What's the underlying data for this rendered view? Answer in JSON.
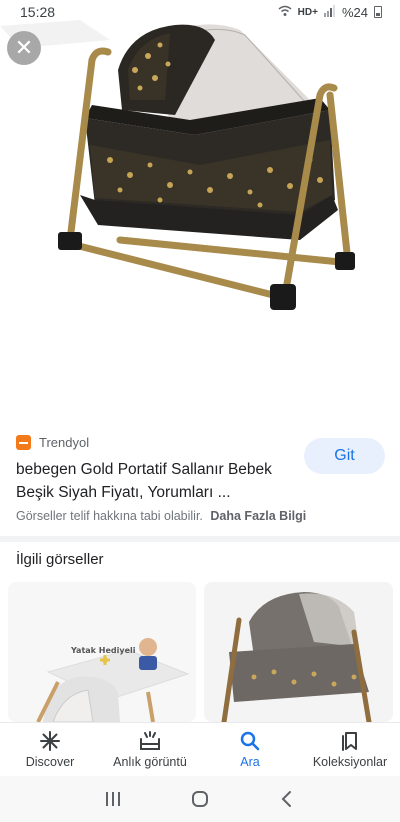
{
  "status_bar": {
    "time": "15:28",
    "network": "HD+",
    "battery": "%24"
  },
  "result": {
    "source": "Trendyol",
    "go_label": "Git",
    "title": "bebegen Gold Portatif Sallanır Bebek Beşik Siyah Fiyatı, Yorumları ...",
    "copyright_notice": "Görseller telif hakkına tabi olabilir.",
    "more_info": "Daha Fazla Bilgi"
  },
  "related": {
    "heading": "İlgili görseller",
    "thumb1_caption": "Yatak Hediyeli"
  },
  "bottom_nav": [
    {
      "label": "Discover",
      "icon": "asterisk-icon"
    },
    {
      "label": "Anlık görüntü",
      "icon": "snapshot-icon"
    },
    {
      "label": "Ara",
      "icon": "search-icon",
      "active": true
    },
    {
      "label": "Koleksiyonlar",
      "icon": "bookmark-icon"
    }
  ],
  "colors": {
    "accent": "#1a73e8",
    "go_bg": "#e8f0fe",
    "crib_frame": "#a88a4a",
    "crib_fabric": "#2d2a25"
  }
}
